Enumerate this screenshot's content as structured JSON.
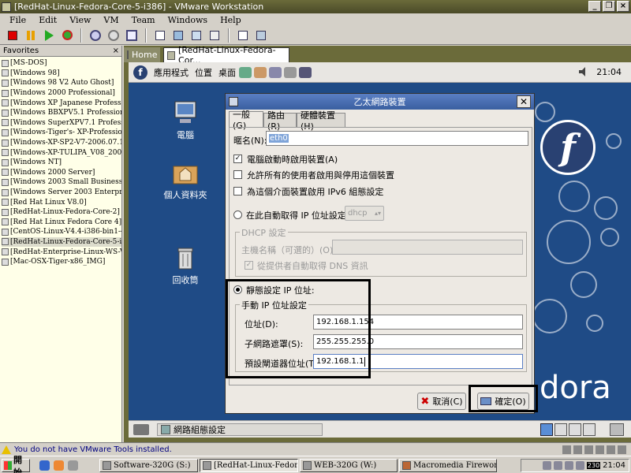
{
  "window": {
    "title": "[RedHat-Linux-Fedora-Core-5-i386] - VMware Workstation"
  },
  "menu": [
    "File",
    "Edit",
    "View",
    "VM",
    "Team",
    "Windows",
    "Help"
  ],
  "favorites": {
    "header": "Favorites",
    "items": [
      "[MS-DOS]",
      "[Windows 98]",
      "[Windows 98 V2 Auto Ghost]",
      "[Windows 2000 Professional]",
      "[Windows XP Japanese Professional",
      "[Windows BBXPV5.1 Professional]",
      "[Windows SuperXPV7.1 Profession",
      "[Windows-Tiger's- XP-Professional-",
      "[Windows-XP-SP2-V7-2006.07.14_",
      "[Windows-XP-TULIPA_V08_2006.",
      "[Windows NT]",
      "[Windows 2000 Server]",
      "[Windows 2003 Small Business Serv",
      "[Windows Server 2003 Enterprise E",
      "[Red Hat Linux V8.0]",
      "[RedHat-Linux-Fedora-Core-2]",
      "[Red Hat Linux Fedora Core 4]",
      "[CentOS-Linux-V4.4-i386-bin1-4]",
      "[RedHat-Linux-Fedora-Core-5-i386",
      "[RedHat-Enterprise-Linux-WS-V4.0",
      "[Mac-OSX-Tiger-x86_IMG]"
    ],
    "selected_index": 18
  },
  "tabs": {
    "home": "Home",
    "vm": "[RedHat-Linux-Fedora-Cor..."
  },
  "guest": {
    "panel": {
      "apps": "應用程式",
      "places": "位置",
      "desktop": "桌面",
      "clock": "21:04"
    },
    "icons": {
      "computer": "電腦",
      "home": "個人資料夾",
      "trash": "回收筒"
    },
    "brand": "dora",
    "taskbar_item": "網路組態設定"
  },
  "dialog": {
    "title": "乙太網路裝置",
    "tabs": [
      "一般(G)",
      "路由(R)",
      "硬體裝置(H)"
    ],
    "name_label": "暱名(N):",
    "name_value": "eth0",
    "cb_boot": "電腦啟動時啟用裝置(A)",
    "cb_users": "允許所有的使用者啟用與停用這個裝置",
    "cb_ipv6": "為這個介面裝置啟用 IPv6 組態設定",
    "radio_auto": "在此自動取得 IP 位址設定:",
    "auto_method": "dhcp",
    "dhcp_group": "DHCP 設定",
    "hostname_label": "主機名稱（可選的）(O):",
    "dns_label": "從提供者自動取得 DNS 資訊",
    "radio_static": "靜態設定 IP 位址:",
    "manual_group": "手動 IP 位址設定",
    "ip_label": "位址(D):",
    "ip_value": "192.168.1.154",
    "mask_label": "子網路遮罩(S):",
    "mask_value": "255.255.255.0",
    "gw_label": "預設閘道器位址(T):",
    "gw_value": "192.168.1.1",
    "cancel": "取消(C)",
    "ok": "確定(O)"
  },
  "status": {
    "message": "You do not have VMware Tools installed."
  },
  "taskbar": {
    "start": "開始",
    "tasks": [
      "Software-320G (S:)",
      "[RedHat-Linux-Fedora-C...",
      "WEB-320G (W:)",
      "Macromedia Fireworks M..."
    ],
    "tray_clock": "21:04",
    "tray_badge": "230"
  }
}
